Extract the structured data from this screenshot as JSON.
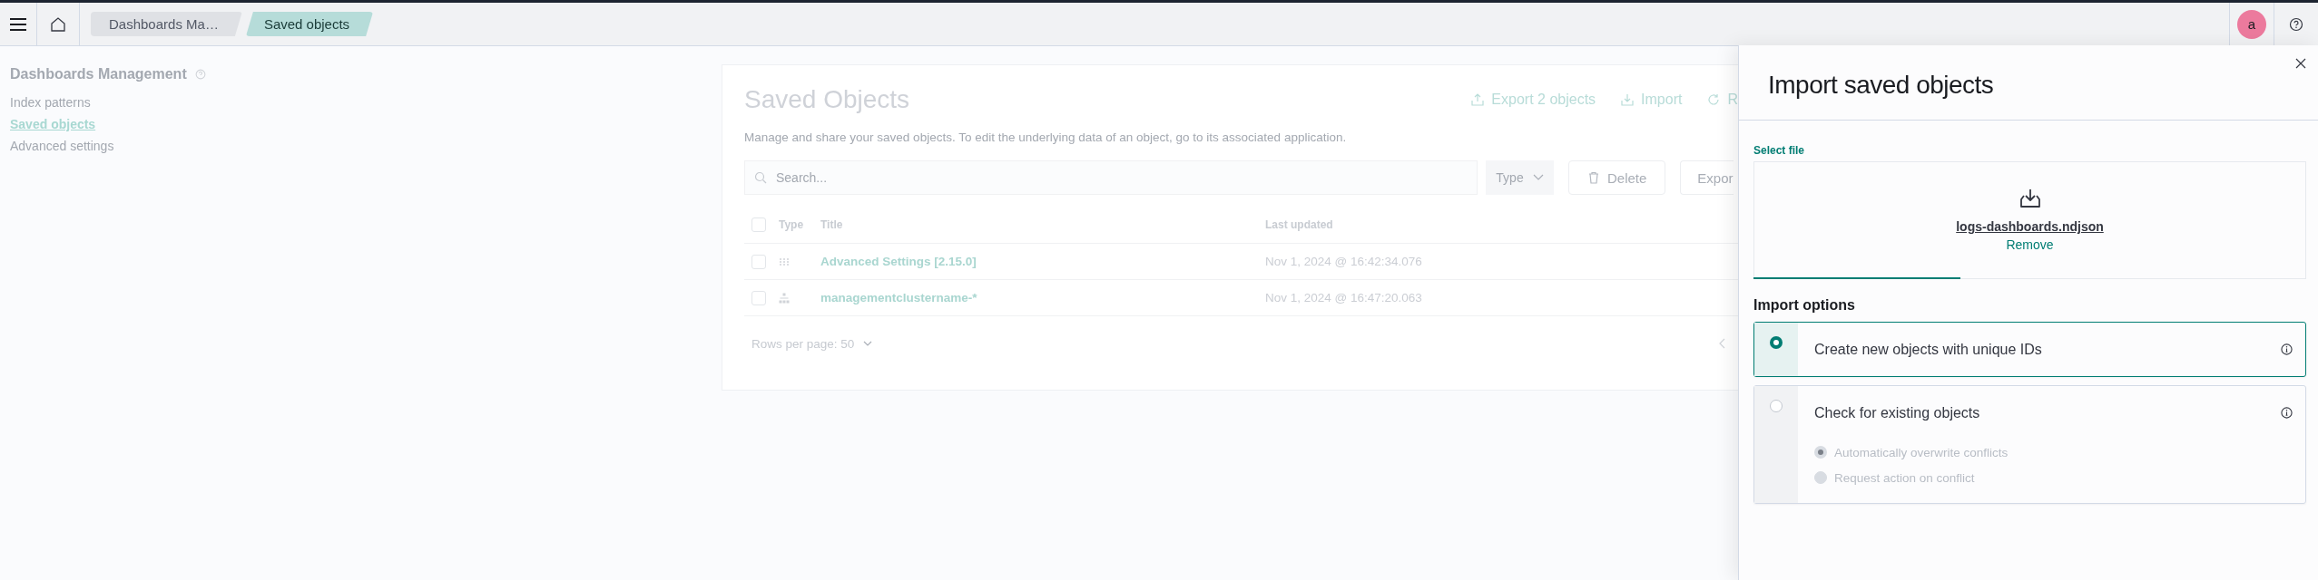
{
  "header": {
    "breadcrumbs": [
      {
        "label": "Dashboards Ma…",
        "selected": false
      },
      {
        "label": "Saved objects",
        "selected": true
      }
    ],
    "avatar": "a"
  },
  "sidebar": {
    "title": "Dashboards Management",
    "items": [
      {
        "label": "Index patterns",
        "selected": false
      },
      {
        "label": "Saved objects",
        "selected": true
      },
      {
        "label": "Advanced settings",
        "selected": false
      }
    ]
  },
  "saved_objects": {
    "title": "Saved Objects",
    "actions": [
      {
        "kind": "export",
        "label": "Export 2 objects"
      },
      {
        "kind": "import",
        "label": "Import"
      },
      {
        "kind": "refresh",
        "label": "R"
      }
    ],
    "description": "Manage and share your saved objects. To edit the underlying data of an object, go to its associated application.",
    "search": {
      "placeholder": "Search..."
    },
    "type_filter": "Type",
    "delete_button": "Delete",
    "export_button": "Expor",
    "select_all_checked": false,
    "columns": [
      "Type",
      "Title",
      "Last updated"
    ],
    "rows": [
      {
        "kind": "config",
        "title": "Advanced Settings [2.15.0]",
        "last_updated": "Nov 1, 2024 @ 16:42:34.076",
        "checked": false
      },
      {
        "kind": "index-pattern",
        "title": "managementclustername-*",
        "last_updated": "Nov 1, 2024 @ 16:47:20.063",
        "checked": false
      }
    ],
    "rows_per_page": "Rows per page: 50"
  },
  "flyout": {
    "title": "Import saved objects",
    "file_label": "Select file",
    "file_name": "logs-dashboards.ndjson",
    "remove": "Remove",
    "options_title": "Import options",
    "options": [
      {
        "label": "Create new objects with unique IDs",
        "selected": true
      },
      {
        "label": "Check for existing objects",
        "selected": false,
        "sub_options": [
          {
            "label": "Automatically overwrite conflicts",
            "selected": true,
            "disabled": true
          },
          {
            "label": "Request action on conflict",
            "selected": false,
            "disabled": true
          }
        ]
      }
    ]
  }
}
